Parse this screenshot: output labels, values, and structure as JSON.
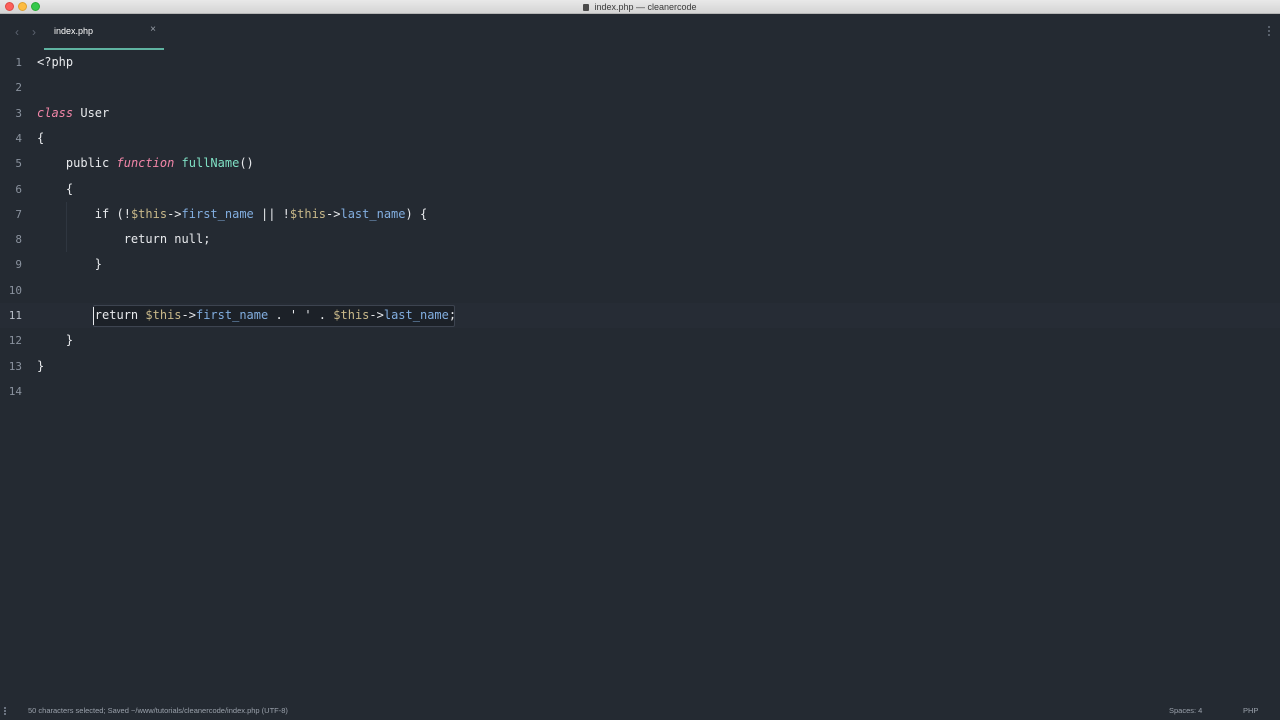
{
  "window": {
    "title": "index.php — cleanercode"
  },
  "tabs": [
    {
      "label": "index.php",
      "close_glyph": "×",
      "active": true
    }
  ],
  "nav": {
    "back_glyph": "‹",
    "forward_glyph": "›"
  },
  "editor": {
    "language": "php",
    "current_line": 11,
    "lines": [
      {
        "number": "1",
        "code": "<?php"
      },
      {
        "number": "2",
        "code": ""
      },
      {
        "number": "3",
        "code": "class User"
      },
      {
        "number": "4",
        "code": "{"
      },
      {
        "number": "5",
        "code": "    public function fullName()"
      },
      {
        "number": "6",
        "code": "    {"
      },
      {
        "number": "7",
        "code": "        if (!$this->first_name || !$this->last_name) {"
      },
      {
        "number": "8",
        "code": "            return null;"
      },
      {
        "number": "9",
        "code": "        }"
      },
      {
        "number": "10",
        "code": ""
      },
      {
        "number": "11",
        "code": "        return $this->first_name . ' ' . $this->last_name;"
      },
      {
        "number": "12",
        "code": "    }"
      },
      {
        "number": "13",
        "code": "}"
      },
      {
        "number": "14",
        "code": ""
      }
    ]
  },
  "statusbar": {
    "message": "50 characters selected; Saved ~/www/tutorials/cleanercode/index.php (UTF-8)",
    "spaces": "Spaces: 4",
    "syntax": "PHP"
  },
  "colors": {
    "background": "#242a32",
    "tab_underline": "#5fb3a1",
    "keyword_italic": "#f286a8",
    "function_name": "#7fe0c4",
    "variable": "#c9b98a",
    "property": "#82aee0"
  }
}
